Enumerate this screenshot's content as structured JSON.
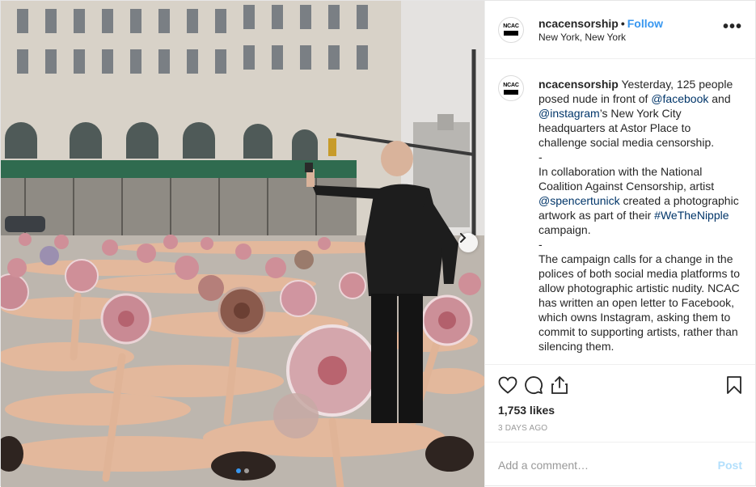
{
  "photo": {
    "alt": "",
    "carousel_index": 1,
    "carousel_count": 2
  },
  "header": {
    "avatar_text": "NCAC",
    "username": "ncacensorship",
    "separator": "•",
    "follow_label": "Follow",
    "location": "New York, New York",
    "more_label": "•••"
  },
  "caption": {
    "avatar_text": "NCAC",
    "username": "ncacensorship",
    "segments": [
      {
        "type": "text",
        "text": " Yesterday, 125 people posed nude in front of "
      },
      {
        "type": "link",
        "text": "@facebook"
      },
      {
        "type": "text",
        "text": " and "
      },
      {
        "type": "link",
        "text": "@instagram"
      },
      {
        "type": "text",
        "text": "’s New York City headquarters at Astor Place to challenge social media censorship."
      },
      {
        "type": "br"
      },
      {
        "type": "text",
        "text": "-"
      },
      {
        "type": "br"
      },
      {
        "type": "text",
        "text": "In collaboration with the National Coalition Against Censorship, artist "
      },
      {
        "type": "link",
        "text": "@spencertunick"
      },
      {
        "type": "text",
        "text": " created a photographic artwork as part of their "
      },
      {
        "type": "link",
        "text": "#WeTheNipple"
      },
      {
        "type": "text",
        "text": " campaign."
      },
      {
        "type": "br"
      },
      {
        "type": "text",
        "text": "-"
      },
      {
        "type": "br"
      },
      {
        "type": "text",
        "text": "The campaign calls for a change in the polices of both social media platforms to allow photographic artistic nudity. NCAC has written an open letter to Facebook, which owns Instagram, asking them to commit to supporting artists, rather than silencing them."
      }
    ]
  },
  "actions": {
    "icons": [
      "heart-icon",
      "comment-icon",
      "share-icon",
      "bookmark-icon"
    ],
    "likes": "1,753 likes",
    "timestamp": "3 DAYS AGO"
  },
  "comment": {
    "placeholder": "Add a comment…",
    "post_label": "Post"
  },
  "colors": {
    "accent": "#3897f0",
    "link": "#003569",
    "post_disabled": "#b2dffc"
  }
}
